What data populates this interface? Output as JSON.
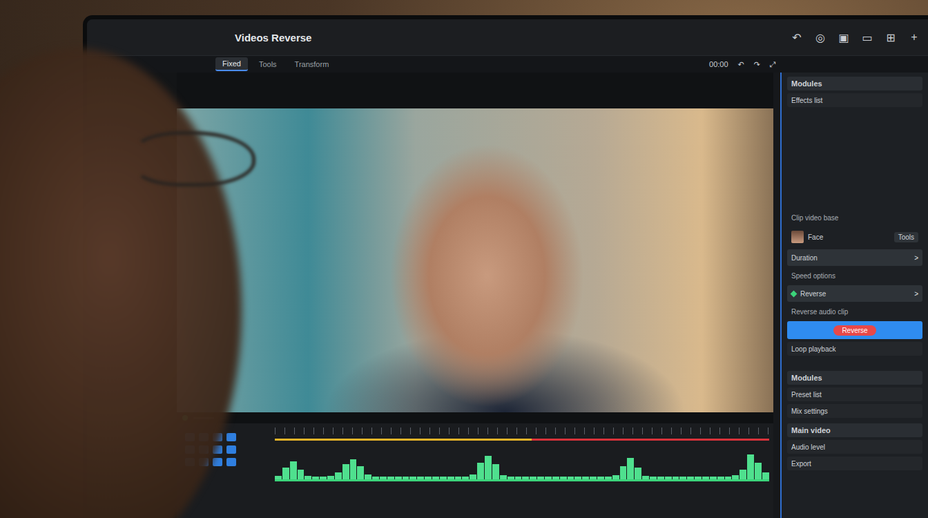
{
  "window": {
    "title": "Videos Reverse"
  },
  "top_icons": [
    "↶",
    "◎",
    "▣",
    "▭",
    "⊞",
    "+"
  ],
  "tabs": [
    {
      "label": "Fixed",
      "selected": true
    },
    {
      "label": "Tools",
      "selected": false
    },
    {
      "label": "Transform",
      "selected": false
    }
  ],
  "preview_tools": [
    "00:00",
    "↶",
    "↷",
    "⤢"
  ],
  "right_panel": {
    "sections": [
      {
        "items": [
          {
            "kind": "section",
            "label": "Modules"
          },
          {
            "kind": "row",
            "label": "Effects list"
          }
        ]
      },
      {
        "items": [
          {
            "kind": "small",
            "label": "Clip video base"
          },
          {
            "kind": "thumb",
            "label": "Face",
            "badge": "Tools"
          },
          {
            "kind": "select",
            "label": "Duration",
            "arrow": ">"
          },
          {
            "kind": "small",
            "label": "Speed options"
          },
          {
            "kind": "select",
            "label": "Reverse",
            "arrow": ">"
          },
          {
            "kind": "small",
            "label": "Reverse audio clip"
          },
          {
            "kind": "button",
            "label": "Reverse"
          },
          {
            "kind": "row",
            "label": "Loop playback"
          }
        ]
      },
      {
        "items": [
          {
            "kind": "section",
            "label": "Modules"
          },
          {
            "kind": "row",
            "label": "Preset list"
          },
          {
            "kind": "row",
            "label": "Mix settings"
          }
        ]
      },
      {
        "items": [
          {
            "kind": "section",
            "label": "Main video"
          },
          {
            "kind": "row",
            "label": "Audio level"
          },
          {
            "kind": "row",
            "label": "Export"
          }
        ]
      }
    ]
  },
  "timeline": {
    "progress": 0.52,
    "waveform": [
      0.1,
      0.35,
      0.55,
      0.3,
      0.1,
      0.08,
      0.08,
      0.1,
      0.2,
      0.45,
      0.6,
      0.4,
      0.15,
      0.08,
      0.08,
      0.08,
      0.08,
      0.08,
      0.08,
      0.08,
      0.08,
      0.08,
      0.08,
      0.08,
      0.08,
      0.08,
      0.15,
      0.5,
      0.7,
      0.45,
      0.12,
      0.08,
      0.08,
      0.08,
      0.08,
      0.08,
      0.08,
      0.08,
      0.08,
      0.08,
      0.08,
      0.08,
      0.08,
      0.08,
      0.08,
      0.12,
      0.4,
      0.65,
      0.35,
      0.1,
      0.08,
      0.08,
      0.08,
      0.08,
      0.08,
      0.08,
      0.08,
      0.08,
      0.08,
      0.08,
      0.08,
      0.12,
      0.3,
      0.75,
      0.5,
      0.2
    ]
  }
}
